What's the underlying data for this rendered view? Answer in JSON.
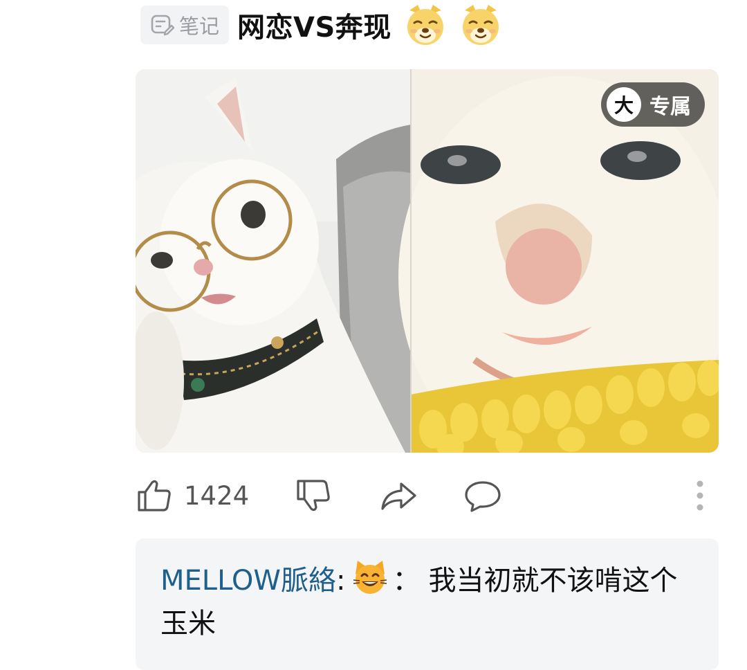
{
  "post": {
    "tag_label": "笔记",
    "title": "网恋VS奔现",
    "title_emojis": [
      "doge-emoji",
      "doge-emoji"
    ]
  },
  "media": {
    "badge_icon_text": "大",
    "badge_label": "专属"
  },
  "actions": {
    "like_count": "1424"
  },
  "comment": {
    "author": "MELLOW脈絡",
    "separator": ":",
    "quote_separator": "：",
    "text": "我当初就不该啃这个玉米"
  },
  "colors": {
    "author_link": "#1f5f8b",
    "comment_bg": "#f4f5f7",
    "tag_bg": "#f2f3f5"
  }
}
